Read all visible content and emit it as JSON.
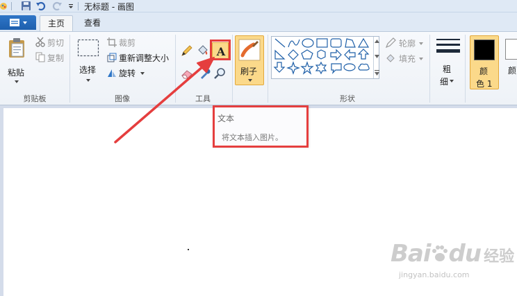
{
  "window": {
    "title": "无标题 - 画图"
  },
  "tabs": [
    {
      "label": "主页",
      "active": true
    },
    {
      "label": "查看",
      "active": false
    }
  ],
  "groups": {
    "clipboard": {
      "label": "剪贴板",
      "paste_label": "粘贴",
      "cut_label": "剪切",
      "copy_label": "复制"
    },
    "image": {
      "label": "图像",
      "select_label": "选择",
      "crop_label": "裁剪",
      "resize_label": "重新调整大小",
      "rotate_label": "旋转"
    },
    "tools": {
      "label": "工具"
    },
    "brushes": {
      "label": "刷子"
    },
    "shapes": {
      "label": "形状",
      "outline_label": "轮廓",
      "fill_label": "填充"
    },
    "size": {
      "label_line1": "粗",
      "label_line2": "细"
    },
    "colors": {
      "color1_line1": "颜",
      "color1_line2": "色 1",
      "color2_line1": "颜",
      "color1_value": "#000000",
      "color2_value": "#ffffff"
    }
  },
  "tooltip": {
    "title": "文本",
    "description": "将文本插入图片。"
  },
  "watermark": {
    "brand": "Bai",
    "brand2": "du",
    "suffix": "经验",
    "url": "jingyan.baidu.com"
  },
  "colors": {
    "accent_blue": "#2f76c7",
    "highlight_red": "#e53e3e",
    "selected_orange": "#fbd98a"
  }
}
